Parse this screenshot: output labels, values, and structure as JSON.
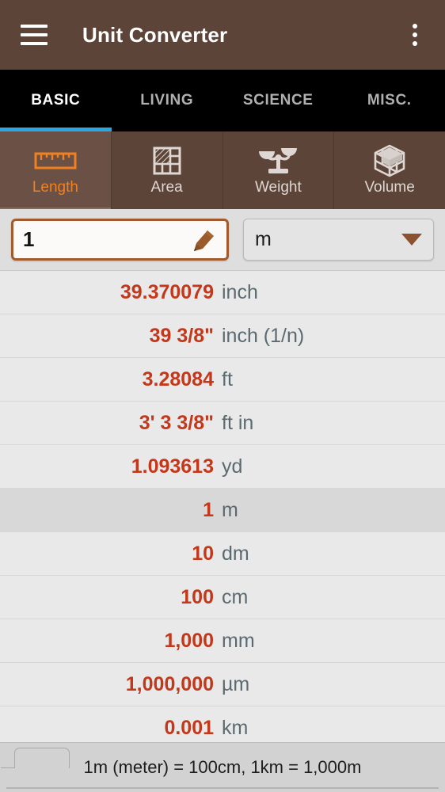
{
  "appbar": {
    "title": "Unit Converter",
    "menu_icon": "hamburger-menu-icon",
    "overflow_icon": "more-vertical-icon"
  },
  "section_tabs": [
    {
      "label": "BASIC",
      "active": true
    },
    {
      "label": "LIVING",
      "active": false
    },
    {
      "label": "SCIENCE",
      "active": false
    },
    {
      "label": "MISC.",
      "active": false
    }
  ],
  "category_tabs": [
    {
      "label": "Length",
      "icon": "ruler-icon",
      "active": true
    },
    {
      "label": "Area",
      "icon": "grid-square-icon",
      "active": false
    },
    {
      "label": "Weight",
      "icon": "balance-scale-icon",
      "active": false
    },
    {
      "label": "Volume",
      "icon": "cube-icon",
      "active": false
    }
  ],
  "input": {
    "value": "1",
    "placeholder": "1",
    "edit_icon": "pencil-icon",
    "unit": "m",
    "caret_icon": "chevron-down-icon"
  },
  "results": [
    {
      "value": "39.370079",
      "unit": "inch",
      "selected": false
    },
    {
      "value": "39 3/8\"",
      "unit": "inch (1/n)",
      "selected": false
    },
    {
      "value": "3.28084",
      "unit": "ft",
      "selected": false
    },
    {
      "value": "3' 3 3/8\"",
      "unit": "ft in",
      "selected": false
    },
    {
      "value": "1.093613",
      "unit": "yd",
      "selected": false
    },
    {
      "value": "1",
      "unit": "m",
      "selected": true
    },
    {
      "value": "10",
      "unit": "dm",
      "selected": false
    },
    {
      "value": "100",
      "unit": "cm",
      "selected": false
    },
    {
      "value": "1,000",
      "unit": "mm",
      "selected": false
    },
    {
      "value": "1,000,000",
      "unit": "µm",
      "selected": false
    },
    {
      "value": "0.001",
      "unit": "km",
      "selected": false
    }
  ],
  "bottom_bar": {
    "tip": "1m (meter) = 100cm, 1km = 1,000m"
  },
  "colors": {
    "appbar_bg": "#5c4438",
    "section_tab_bg": "#000000",
    "tab_indicator": "#2da6e0",
    "accent_orange": "#f08020",
    "value_red": "#c3371a",
    "unit_gray": "#5b6a70",
    "list_bg": "#e9e9e9",
    "row_selected_bg": "#d8d8d8",
    "input_border": "#a05a2c",
    "bottom_bar_bg": "#d2d2d2"
  }
}
